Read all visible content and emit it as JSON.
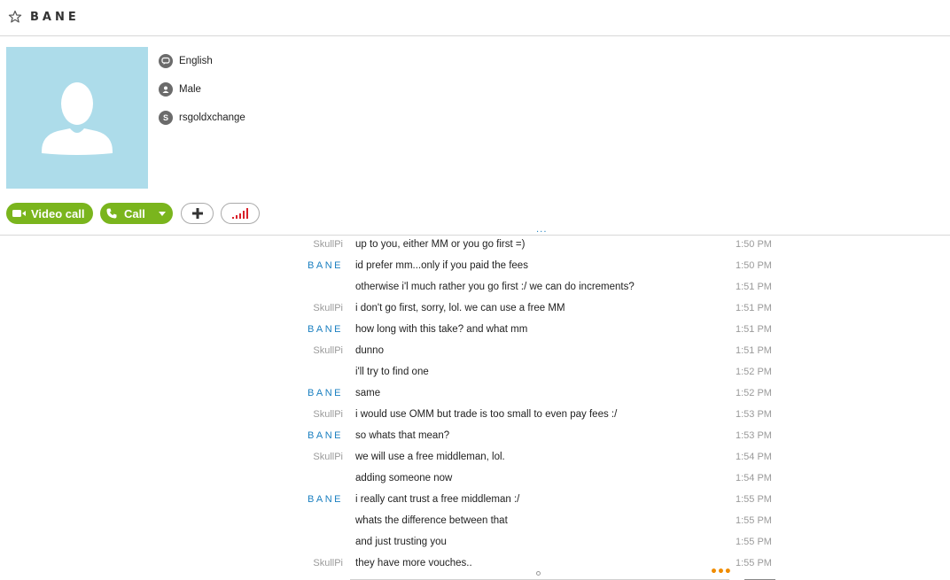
{
  "header": {
    "title": "BANE"
  },
  "profile": {
    "language": "English",
    "gender": "Male",
    "skype_name": "rsgoldxchange"
  },
  "actions": {
    "video_call_label": "Video call",
    "call_label": "Call"
  },
  "splitter_label": "...",
  "messages": [
    {
      "sender": "SkullPi",
      "text": "up to you, either MM or you go first =)",
      "time": "1:50 PM"
    },
    {
      "sender": "BANE",
      "text": "id prefer mm...only if you paid the fees",
      "time": "1:50 PM"
    },
    {
      "sender": "",
      "text": "otherwise i'l much rather you go first :/ we can do increments?",
      "time": "1:51 PM"
    },
    {
      "sender": "SkullPi",
      "text": "i don't go first, sorry, lol. we can use a free MM",
      "time": "1:51 PM"
    },
    {
      "sender": "BANE",
      "text": "how long with this take? and what mm",
      "time": "1:51 PM"
    },
    {
      "sender": "SkullPi",
      "text": "dunno",
      "time": "1:51 PM"
    },
    {
      "sender": "",
      "text": "i'll try to find one",
      "time": "1:52 PM"
    },
    {
      "sender": "BANE",
      "text": "same",
      "time": "1:52 PM"
    },
    {
      "sender": "SkullPi",
      "text": "i would use OMM but trade is too small to even pay fees :/",
      "time": "1:53 PM"
    },
    {
      "sender": "BANE",
      "text": "so whats that mean?",
      "time": "1:53 PM"
    },
    {
      "sender": "SkullPi",
      "text": "we will use a free middleman, lol.",
      "time": "1:54 PM"
    },
    {
      "sender": "",
      "text": "adding someone now",
      "time": "1:54 PM"
    },
    {
      "sender": "BANE",
      "text": "i really cant trust a free middleman :/",
      "time": "1:55 PM"
    },
    {
      "sender": "",
      "text": "whats the difference between that",
      "time": "1:55 PM"
    },
    {
      "sender": "",
      "text": "and just trusting you",
      "time": "1:55 PM"
    },
    {
      "sender": "SkullPi",
      "text": "they have more vouches..",
      "time": "1:55 PM"
    }
  ],
  "more_indicator": "•••",
  "colors": {
    "accent_green": "#7ab51d",
    "link_blue": "#1a7fc0",
    "avatar_bg": "#addcea",
    "signal_red": "#d9202a"
  },
  "icons": {
    "favorite": "star-icon",
    "language": "speech-bubble-icon",
    "gender": "person-icon",
    "skype": "skype-icon",
    "video": "video-camera-icon",
    "call": "phone-icon",
    "add": "plus-icon",
    "signal": "signal-bars-icon"
  }
}
